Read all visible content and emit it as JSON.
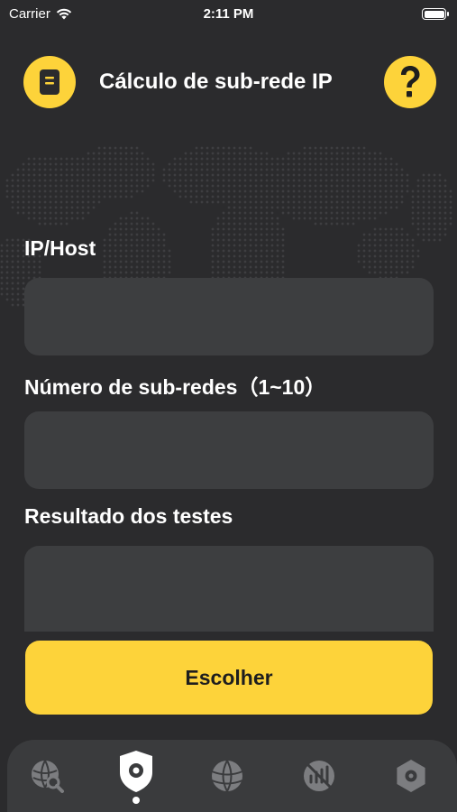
{
  "status_bar": {
    "carrier": "Carrier",
    "time": "2:11 PM"
  },
  "header": {
    "title": "Cálculo de sub-rede IP",
    "left_icon": "document-icon",
    "right_icon": "question-icon"
  },
  "form": {
    "ip_label": "IP/Host",
    "ip_value": "",
    "subnets_label": "Número de sub-redes（1~10）",
    "subnets_value": "",
    "results_label": "Resultado dos testes",
    "results_value": ""
  },
  "action_button": "Escolher",
  "tabs": [
    {
      "icon": "globe-search-icon",
      "active": false
    },
    {
      "icon": "shield-location-icon",
      "active": true
    },
    {
      "icon": "globe-icon",
      "active": false
    },
    {
      "icon": "no-signal-icon",
      "active": false
    },
    {
      "icon": "settings-gear-icon",
      "active": false
    }
  ],
  "colors": {
    "background": "#2b2b2d",
    "accent": "#fdd33a",
    "field": "#3d3e40",
    "tab_bar": "#3a3b3d"
  }
}
